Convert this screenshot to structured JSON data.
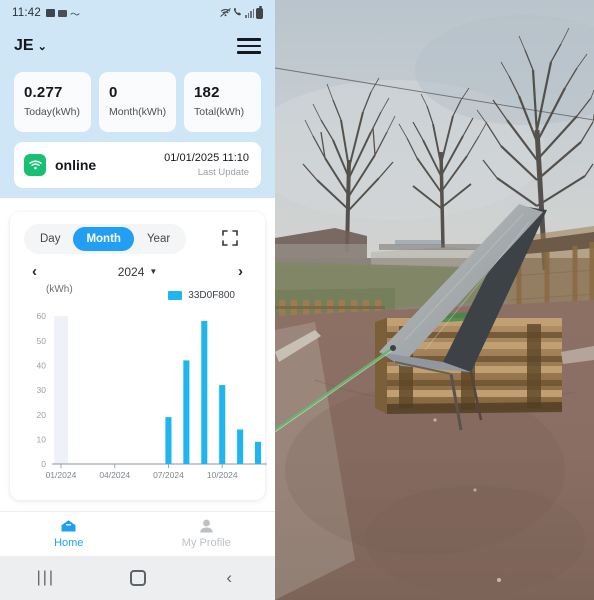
{
  "statusbar": {
    "time": "11:42",
    "icons_left": [
      "sim-card-icon",
      "mail-icon",
      "squiggle-icon"
    ],
    "icons_right": [
      "wifi-off-icon",
      "call-icon",
      "signal-bars-icon",
      "battery-icon"
    ]
  },
  "appbar": {
    "brand": "JE",
    "caret": "⌄",
    "menu_icon": "hamburger-menu-icon"
  },
  "stats": [
    {
      "value": "0.277",
      "label": "Today(kWh)"
    },
    {
      "value": "0",
      "label": "Month(kWh)"
    },
    {
      "value": "182",
      "label": "Total(kWh)"
    }
  ],
  "status_card": {
    "icon": "wifi-icon",
    "state": "online",
    "timestamp": "01/01/2025 11:10",
    "caption": "Last Update",
    "badge_color": "#18c073"
  },
  "chart_card": {
    "range_tabs": [
      {
        "label": "Day",
        "selected": false
      },
      {
        "label": "Month",
        "selected": true
      },
      {
        "label": "Year",
        "selected": false
      }
    ],
    "expand_icon": "fullscreen-expand-icon",
    "prev_icon": "‹",
    "next_icon": "›",
    "period": "2024",
    "period_caret": "▼",
    "accent_color": "#229ef5"
  },
  "chart_data": {
    "type": "bar",
    "title": "",
    "ylabel": "(kWh)",
    "xlabel": "",
    "ylim": [
      0,
      60
    ],
    "yticks": [
      0,
      10,
      20,
      30,
      40,
      50,
      60
    ],
    "grid": false,
    "legend_position": "top-right",
    "series": [
      {
        "name": "33D0F800",
        "color": "#1fb6f0",
        "values": [
          0,
          0,
          0,
          0,
          0,
          0,
          19,
          42,
          58,
          32,
          14,
          9
        ]
      }
    ],
    "categories": [
      "01/2024",
      "02/2024",
      "03/2024",
      "04/2024",
      "05/2024",
      "06/2024",
      "07/2024",
      "08/2024",
      "09/2024",
      "10/2024",
      "11/2024",
      "12/2024"
    ],
    "xtick_labels": [
      "01/2024",
      "04/2024",
      "07/2024",
      "10/2024"
    ],
    "highlighted_category": "01/2024"
  },
  "tabbar": [
    {
      "icon": "home-icon",
      "label": "Home",
      "active": true
    },
    {
      "icon": "person-icon",
      "label": "My Profile",
      "active": false
    }
  ],
  "android_nav": [
    {
      "icon": "recents-icon",
      "label": "|||"
    },
    {
      "icon": "home-square-icon",
      "label": ""
    },
    {
      "icon": "back-chevron-icon",
      "label": "‹"
    }
  ],
  "photo": {
    "description": "solar-panel-on-pallets-outdoors",
    "sky_color": "#c6cdd2",
    "ground_color": "#8a7268",
    "panel_color": "#b4b8ba"
  }
}
